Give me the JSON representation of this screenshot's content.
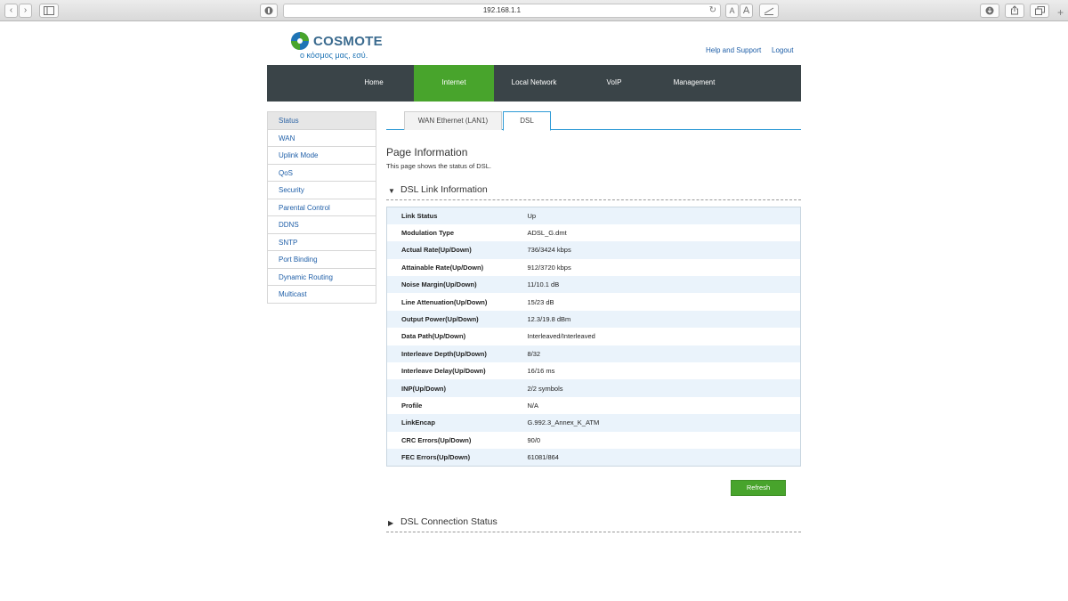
{
  "browser": {
    "url": "192.168.1.1",
    "text_smaller": "A",
    "text_larger": "A"
  },
  "brand": {
    "name": "COSMOTE",
    "tagline": "ο κόσμος μας, εσύ.",
    "colors": {
      "green": "#48a42c",
      "blue": "#1f74b5",
      "nav_bg": "#3a4448"
    }
  },
  "header_links": {
    "help": "Help and Support",
    "logout": "Logout"
  },
  "nav": {
    "items": [
      {
        "label": "Home"
      },
      {
        "label": "Internet",
        "active": true
      },
      {
        "label": "Local Network"
      },
      {
        "label": "VoIP"
      },
      {
        "label": "Management"
      }
    ]
  },
  "sidebar": {
    "items": [
      {
        "label": "Status",
        "active": true
      },
      {
        "label": "WAN"
      },
      {
        "label": "Uplink Mode"
      },
      {
        "label": "QoS"
      },
      {
        "label": "Security"
      },
      {
        "label": "Parental Control"
      },
      {
        "label": "DDNS"
      },
      {
        "label": "SNTP"
      },
      {
        "label": "Port Binding"
      },
      {
        "label": "Dynamic Routing"
      },
      {
        "label": "Multicast"
      }
    ]
  },
  "tabs": [
    {
      "label": "WAN Ethernet (LAN1)"
    },
    {
      "label": "DSL",
      "active": true
    }
  ],
  "page": {
    "title": "Page Information",
    "description": "This page shows the status of DSL."
  },
  "dsl_link": {
    "title": "DSL Link Information",
    "expanded": true,
    "rows": [
      {
        "label": "Link Status",
        "value": "Up"
      },
      {
        "label": "Modulation Type",
        "value": "ADSL_G.dmt"
      },
      {
        "label": "Actual Rate(Up/Down)",
        "value": "736/3424 kbps"
      },
      {
        "label": "Attainable Rate(Up/Down)",
        "value": "912/3720 kbps"
      },
      {
        "label": "Noise Margin(Up/Down)",
        "value": "11/10.1 dB"
      },
      {
        "label": "Line Attenuation(Up/Down)",
        "value": "15/23 dB"
      },
      {
        "label": "Output Power(Up/Down)",
        "value": "12.3/19.8 dBm"
      },
      {
        "label": "Data Path(Up/Down)",
        "value": "Interleaved/Interleaved"
      },
      {
        "label": "Interleave Depth(Up/Down)",
        "value": "8/32"
      },
      {
        "label": "Interleave Delay(Up/Down)",
        "value": "16/16 ms"
      },
      {
        "label": "INP(Up/Down)",
        "value": "2/2 symbols"
      },
      {
        "label": "Profile",
        "value": "N/A"
      },
      {
        "label": "LinkEncap",
        "value": "G.992.3_Annex_K_ATM"
      },
      {
        "label": "CRC Errors(Up/Down)",
        "value": "90/0"
      },
      {
        "label": "FEC Errors(Up/Down)",
        "value": "61081/864"
      }
    ]
  },
  "refresh_label": "Refresh",
  "dsl_connection": {
    "title": "DSL Connection Status",
    "expanded": false
  }
}
